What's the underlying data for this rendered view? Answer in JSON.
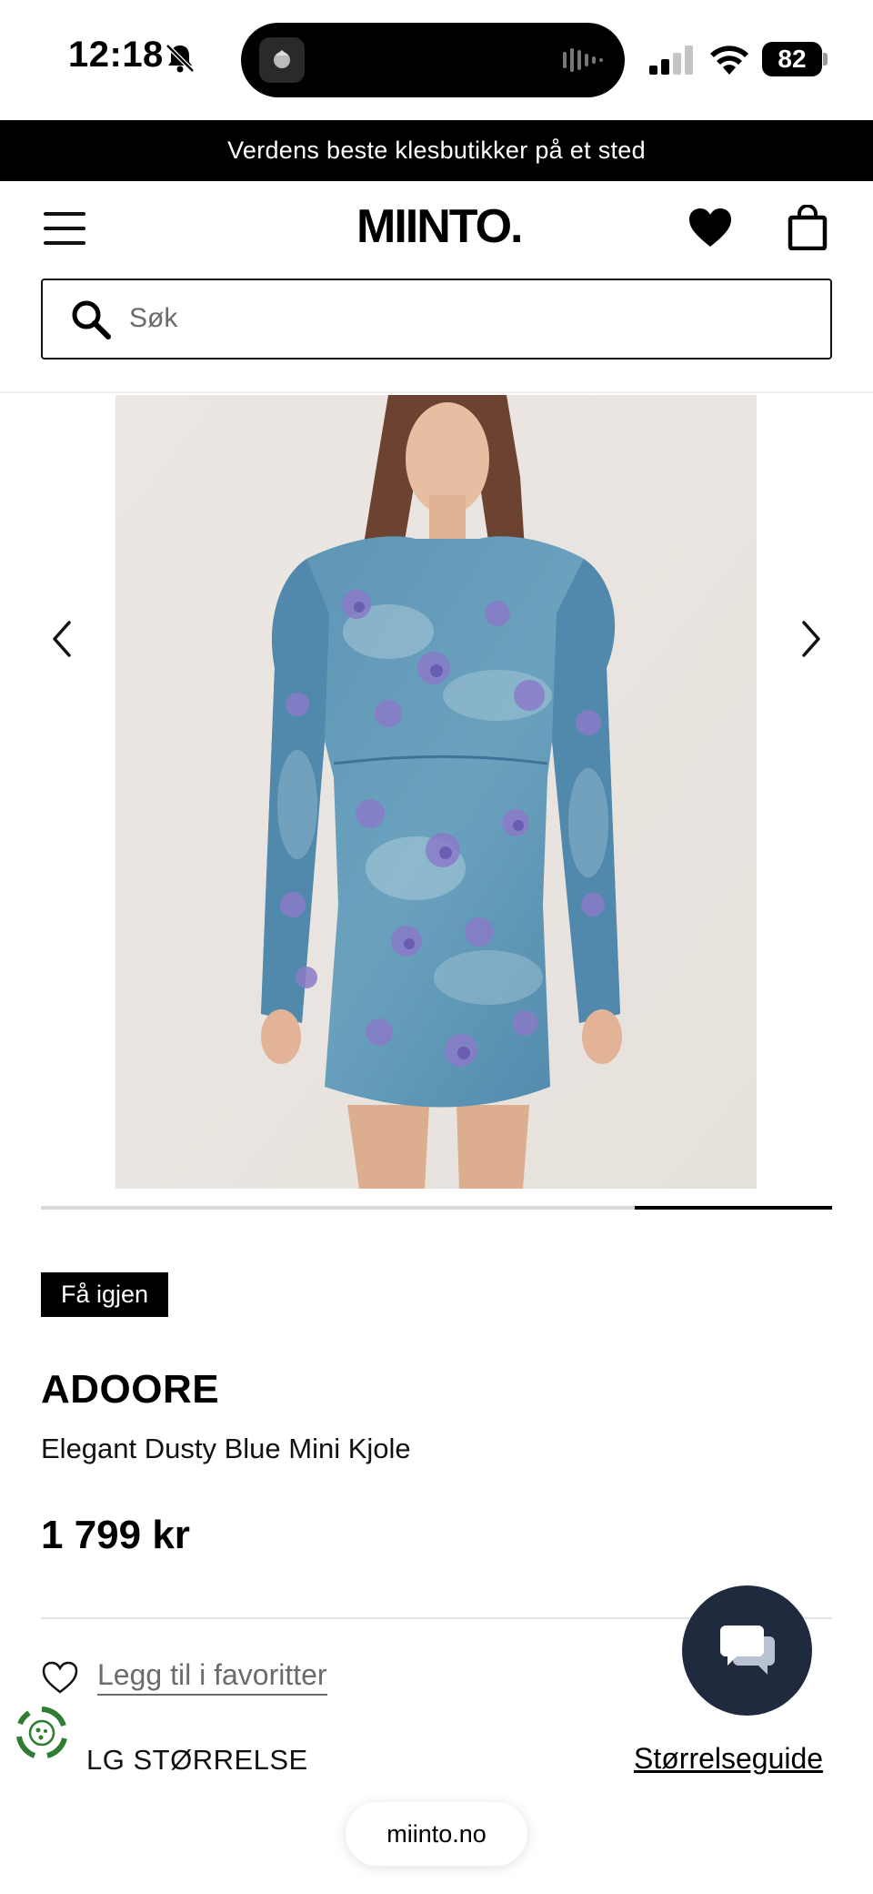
{
  "status_bar": {
    "time": "12:18",
    "battery": "82"
  },
  "promo_banner": "Verdens beste klesbutikker på et sted",
  "header": {
    "logo": "MIINTO."
  },
  "search": {
    "placeholder": "Søk"
  },
  "gallery": {
    "image_count": 4,
    "active_index": 4
  },
  "product": {
    "badge": "Få igjen",
    "brand": "ADOORE",
    "name": "Elegant Dusty Blue Mini Kjole",
    "price": "1 799 kr"
  },
  "favorites": {
    "label": "Legg til i favoritter"
  },
  "size": {
    "label": "LG STØRRELSE",
    "guide_label": "Størrelseguide"
  },
  "browser": {
    "url": "miinto.no"
  },
  "colors": {
    "banner_bg": "#000000",
    "chat_bg": "#1f2a3f",
    "eco_green": "#2e7d32",
    "dress_blue": "#5b8fb0",
    "flower_purple": "#8a7bc8"
  },
  "icons": [
    "bell-slash-icon",
    "waveform-icon",
    "signal-icon",
    "wifi-icon",
    "menu-icon",
    "heart-icon",
    "bag-icon",
    "search-icon",
    "chevron-left-icon",
    "chevron-right-icon",
    "heart-outline-icon",
    "recycle-icon",
    "chat-icon"
  ]
}
